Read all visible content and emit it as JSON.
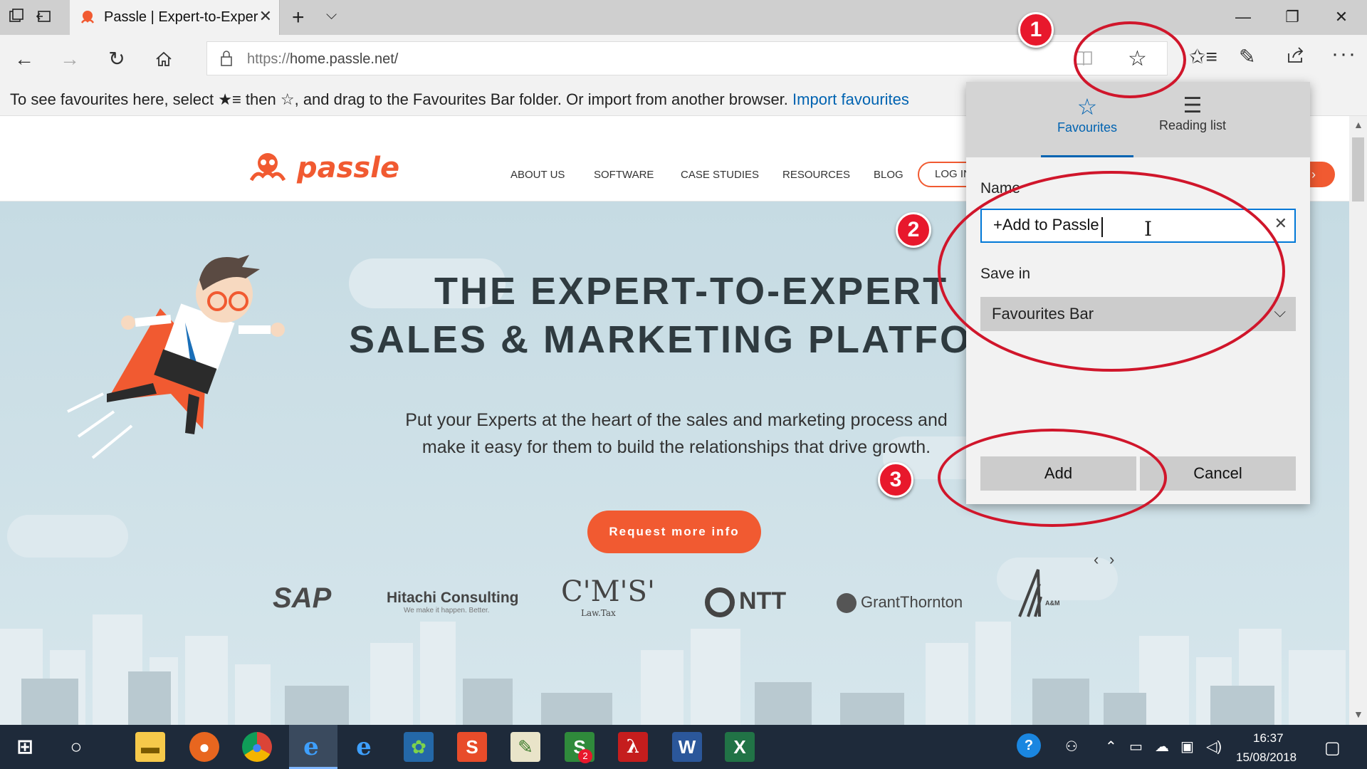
{
  "browser": {
    "tab_title": "Passle | Expert-to-Exper",
    "url_prefix": "https://",
    "url_host": "home.passle.net/",
    "favbar_hint": "To see favourites here, select  ★≡  then ☆, and drag to the Favourites Bar folder. Or import from another browser.",
    "favbar_import_link": "Import favourites",
    "icons": {
      "tab_manager": "tab-manager-icon",
      "set_aside": "set-aside-tabs-icon",
      "back": "back-arrow-icon",
      "forward": "forward-arrow-icon",
      "refresh": "refresh-icon",
      "home": "home-icon",
      "lock": "lock-icon",
      "reading_view": "reading-view-icon",
      "favorite": "star-icon",
      "hub": "favorites-hub-icon",
      "notes": "pen-icon",
      "share": "share-icon",
      "more": "ellipsis-icon"
    }
  },
  "site": {
    "logo_text": "passle",
    "menu": [
      "ABOUT US",
      "SOFTWARE",
      "CASE STUDIES",
      "RESOURCES",
      "BLOG"
    ],
    "login": "LOG IN",
    "hero_line1": "THE EXPERT-TO-EXPERT",
    "hero_line2": "SALES & MARKETING PLATFORM",
    "hero_sub": "Put your Experts at the heart of the sales and marketing process and make it easy for them to build the relationships that drive growth.",
    "cta": "Request more info",
    "carousel_prev": "‹",
    "carousel_next": "›",
    "clients": [
      {
        "name": "SAP"
      },
      {
        "name": "Hitachi Consulting",
        "tagline": "We make it happen. Better."
      },
      {
        "name": "C'M'S'",
        "tagline": "Law.Tax"
      },
      {
        "name": "NTT"
      },
      {
        "name": "GrantThornton"
      },
      {
        "name": "A&M"
      }
    ],
    "brand_color": "#f15a31"
  },
  "flyout": {
    "tab_favourites": "Favourites",
    "tab_reading_list": "Reading list",
    "name_label": "Name",
    "name_value": "+Add to Passle",
    "save_in_label": "Save in",
    "save_in_value": "Favourites Bar",
    "add": "Add",
    "cancel": "Cancel",
    "accent": "#0063b1"
  },
  "annotations": {
    "step1": "1",
    "step2": "2",
    "step3": "3",
    "color": "#d0162b"
  },
  "taskbar": {
    "time": "16:37",
    "date": "15/08/2018",
    "chrome_badge": "2"
  }
}
